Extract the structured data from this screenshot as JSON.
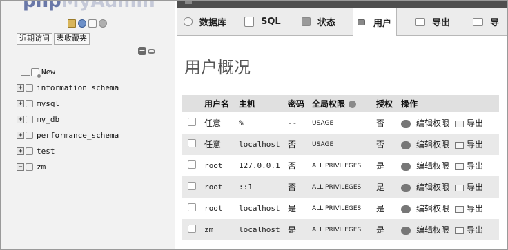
{
  "left_panel": {
    "logo": {
      "part_a": "php",
      "part_b": "MyAdmin"
    },
    "quick_icons": [
      "home-icon",
      "exit-icon",
      "docs-icon",
      "settings-icon"
    ],
    "recent_tabs": [
      "近期访问",
      "表收藏夹"
    ],
    "tree": [
      {
        "label": "New",
        "type": "new"
      },
      {
        "label": "information_schema",
        "type": "db"
      },
      {
        "label": "mysql",
        "type": "db"
      },
      {
        "label": "my_db",
        "type": "db"
      },
      {
        "label": "performance_schema",
        "type": "db"
      },
      {
        "label": "test",
        "type": "db"
      },
      {
        "label": "zm",
        "type": "db-expanded"
      }
    ],
    "expander_plus": "+",
    "expander_minus": "−"
  },
  "tabs": [
    {
      "label": "数据库",
      "icon": "database-icon"
    },
    {
      "label": "SQL",
      "icon": "sql-icon"
    },
    {
      "label": "状态",
      "icon": "status-icon"
    },
    {
      "label": "用户",
      "icon": "users-icon",
      "active": true
    },
    {
      "label": "导出",
      "icon": "export-icon"
    },
    {
      "label": "导",
      "icon": "import-icon"
    }
  ],
  "page_title": "用户概况",
  "table": {
    "headers": [
      "",
      "用户名",
      "主机",
      "密码",
      "全局权限",
      "授权",
      "操作"
    ],
    "rows": [
      {
        "user": "任意",
        "host": "%",
        "password": "--",
        "privileges": "USAGE",
        "grant": "否",
        "edit": "编辑权限",
        "export": "导出"
      },
      {
        "user": "任意",
        "host": "localhost",
        "password": "否",
        "privileges": "USAGE",
        "grant": "否",
        "edit": "编辑权限",
        "export": "导出"
      },
      {
        "user": "root",
        "host": "127.0.0.1",
        "password": "否",
        "privileges": "ALL PRIVILEGES",
        "grant": "是",
        "edit": "编辑权限",
        "export": "导出"
      },
      {
        "user": "root",
        "host": "::1",
        "password": "否",
        "privileges": "ALL PRIVILEGES",
        "grant": "是",
        "edit": "编辑权限",
        "export": "导出"
      },
      {
        "user": "root",
        "host": "localhost",
        "password": "是",
        "privileges": "ALL PRIVILEGES",
        "grant": "是",
        "edit": "编辑权限",
        "export": "导出"
      },
      {
        "user": "zm",
        "host": "localhost",
        "password": "是",
        "privileges": "ALL PRIVILEGES",
        "grant": "是",
        "edit": "编辑权限",
        "export": "导出"
      }
    ]
  },
  "colors": {
    "row_alt": "#e9e9e9",
    "header_bg": "#e0e0e0",
    "tabbar_bg": "#ececec",
    "left_bg": "#f2f2f2"
  }
}
